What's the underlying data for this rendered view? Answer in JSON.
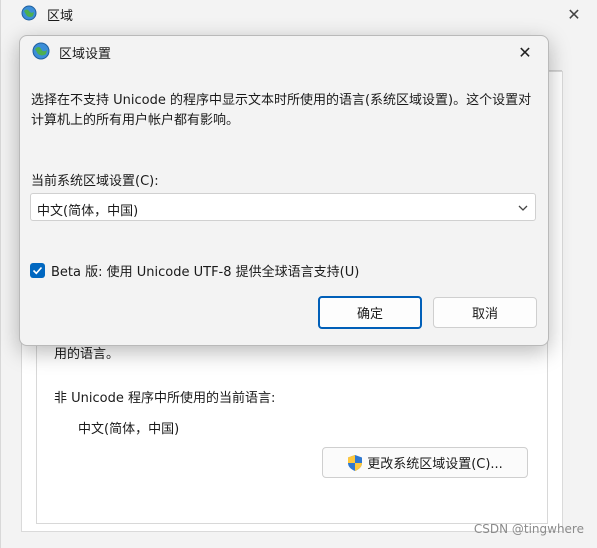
{
  "parent_window": {
    "title": "区域",
    "close_glyph": "✕",
    "wrapped_text_tail": "用的语言。",
    "current_lang_label": "非 Unicode 程序中所使用的当前语言:",
    "current_lang_value": "中文(简体，中国)",
    "change_button_label": "更改系统区域设置(C)...",
    "change_button_icon": "uac-shield-icon"
  },
  "dialog": {
    "title": "区域设置",
    "title_icon": "globe-icon",
    "close_glyph": "✕",
    "description": "选择在不支持 Unicode 的程序中显示文本时所使用的语言(系统区域设置)。这个设置对计算机上的所有用户帐户都有影响。",
    "field_label": "当前系统区域设置(C):",
    "selected_locale": "中文(简体，中国)",
    "beta_checkbox_label": "Beta 版: 使用 Unicode UTF-8 提供全球语言支持(U)",
    "beta_checked": true,
    "ok_label": "确定",
    "cancel_label": "取消"
  },
  "watermark": "CSDN @tingwhere",
  "colors": {
    "accent": "#0067c0",
    "dialog_bg": "#f3f3f3",
    "primary_border": "#005fb8"
  }
}
